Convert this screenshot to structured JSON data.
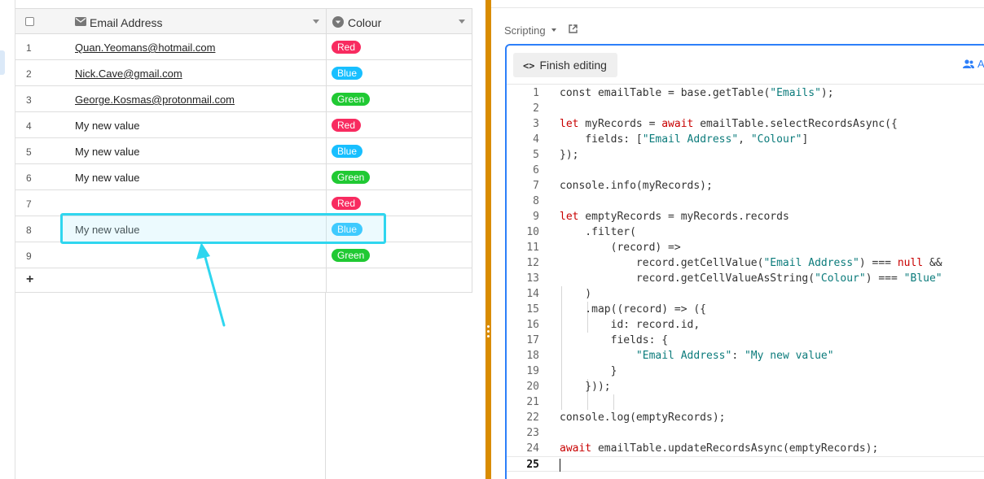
{
  "grid": {
    "columns": {
      "email": "Email Address",
      "colour": "Colour"
    },
    "rows": [
      {
        "num": "1",
        "email": "Quan.Yeomans@hotmail.com",
        "link": true,
        "colour": "Red"
      },
      {
        "num": "2",
        "email": "Nick.Cave@gmail.com",
        "link": true,
        "colour": "Blue"
      },
      {
        "num": "3",
        "email": "George.Kosmas@protonmail.com",
        "link": true,
        "colour": "Green"
      },
      {
        "num": "4",
        "email": "My new value",
        "link": false,
        "colour": "Red"
      },
      {
        "num": "5",
        "email": "My new value",
        "link": false,
        "colour": "Blue"
      },
      {
        "num": "6",
        "email": "My new value",
        "link": false,
        "colour": "Green"
      },
      {
        "num": "7",
        "email": "",
        "link": false,
        "colour": "Red"
      },
      {
        "num": "8",
        "email": "My new value",
        "link": false,
        "colour": "Blue"
      },
      {
        "num": "9",
        "email": "",
        "link": false,
        "colour": "Green"
      }
    ],
    "add_label": "+",
    "colour_styles": {
      "Red": "#f82b60",
      "Blue": "#18bfff",
      "Green": "#20c933"
    }
  },
  "scripting": {
    "label": "Scripting",
    "finish_label": "Finish editing",
    "partial_right_label": "A",
    "code_lines": [
      {
        "n": "1",
        "t": "const emailTable = base.getTable(\"Emails\");"
      },
      {
        "n": "2",
        "t": ""
      },
      {
        "n": "3",
        "t": "let myRecords = await emailTable.selectRecordsAsync({"
      },
      {
        "n": "4",
        "t": "    fields: [\"Email Address\", \"Colour\"]"
      },
      {
        "n": "5",
        "t": "});"
      },
      {
        "n": "6",
        "t": ""
      },
      {
        "n": "7",
        "t": "console.info(myRecords);"
      },
      {
        "n": "8",
        "t": ""
      },
      {
        "n": "9",
        "t": "let emptyRecords = myRecords.records"
      },
      {
        "n": "10",
        "t": "    .filter("
      },
      {
        "n": "11",
        "t": "        (record) =>"
      },
      {
        "n": "12",
        "t": "            record.getCellValue(\"Email Address\") === null &&"
      },
      {
        "n": "13",
        "t": "            record.getCellValueAsString(\"Colour\") === \"Blue\""
      },
      {
        "n": "14",
        "t": "    )"
      },
      {
        "n": "15",
        "t": "    .map((record) => ({"
      },
      {
        "n": "16",
        "t": "        id: record.id,"
      },
      {
        "n": "17",
        "t": "        fields: {"
      },
      {
        "n": "18",
        "t": "            \"Email Address\": \"My new value\""
      },
      {
        "n": "19",
        "t": "        }"
      },
      {
        "n": "20",
        "t": "    }));"
      },
      {
        "n": "21",
        "t": ""
      },
      {
        "n": "22",
        "t": "console.log(emptyRecords);"
      },
      {
        "n": "23",
        "t": ""
      },
      {
        "n": "24",
        "t": "await emailTable.updateRecordsAsync(emptyRecords);"
      },
      {
        "n": "25",
        "t": ""
      }
    ],
    "current_line": "25"
  },
  "icons": {
    "email_column": "envelope-icon",
    "colour_column": "single-select-icon",
    "popout": "popout-icon",
    "finish": "code-brackets-icon",
    "collaborators": "users-icon"
  },
  "accent": "#2d7ff9",
  "divider_color": "#d98c00",
  "annotation_color": "#2fd6ef"
}
